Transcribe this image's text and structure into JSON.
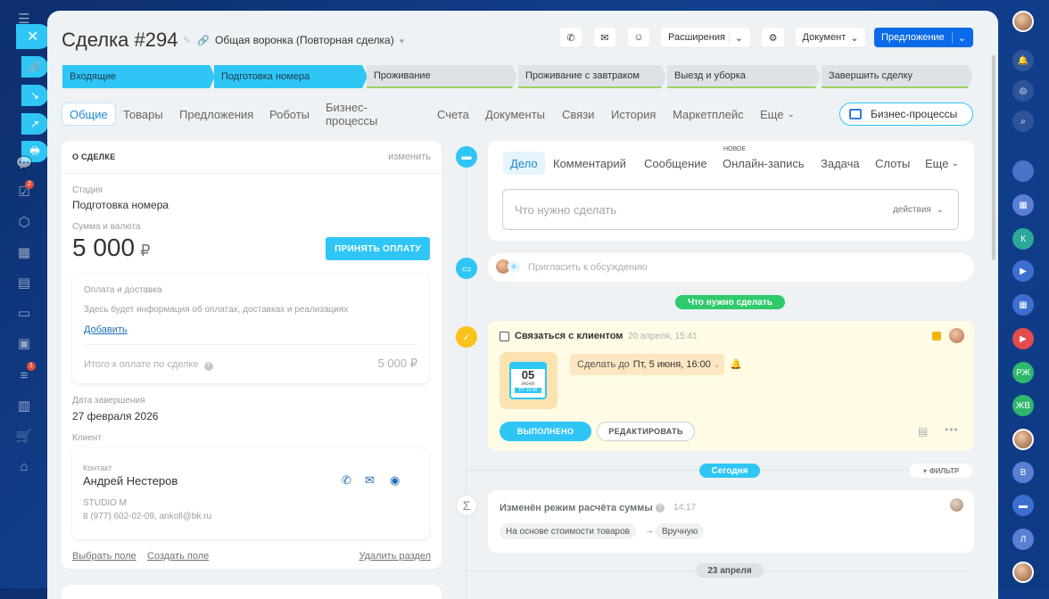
{
  "sidebar_left": {
    "badges": [
      "2",
      "1"
    ]
  },
  "header": {
    "title": "Сделка #294",
    "funnel": "Общая воронка (Повторная сделка)",
    "extensions": "Расширения",
    "document": "Документ",
    "offer": "Предложение"
  },
  "stages": [
    {
      "label": "Входящие",
      "state": "active"
    },
    {
      "label": "Подготовка номера",
      "state": "active"
    },
    {
      "label": "Проживание",
      "state": "inactive"
    },
    {
      "label": "Проживание с завтраком",
      "state": "inactive"
    },
    {
      "label": "Выезд и уборка",
      "state": "inactive"
    },
    {
      "label": "Завершить сделку",
      "state": "inactive"
    }
  ],
  "tabs": [
    "Общие",
    "Товары",
    "Предложения",
    "Роботы",
    "Бизнес-процессы",
    "Счета",
    "Документы",
    "Связи",
    "История",
    "Маркетплейс",
    "Еще"
  ],
  "bp_button": "Бизнес-процессы",
  "deal": {
    "section_title": "О СДЕЛКЕ",
    "edit": "изменить",
    "stage_label": "Стадия",
    "stage_value": "Подготовка номера",
    "sum_label": "Сумма и валюта",
    "sum_value": "5 000",
    "currency": "₽",
    "accept_payment": "ПРИНЯТЬ ОПЛАТУ",
    "payment_title": "Оплата и доставка",
    "payment_text": "Здесь будет информация об оплатах, доставках и реализациях",
    "add_link": "Добавить",
    "total_label": "Итого к оплате по сделке",
    "total_value": "5 000 ₽",
    "close_date_label": "Дата завершения",
    "close_date_value": "27 февраля 2026",
    "client_label": "Клиент",
    "contact_label": "Контакт",
    "contact_name": "Андрей Нестеров",
    "company": "STUDIO M",
    "contact_details": "8 (977) 602-02-09, ankoll@bk.ru",
    "choose_field": "Выбрать поле",
    "create_field": "Создать поле",
    "delete_section": "Удалить раздел"
  },
  "activity": {
    "tabs": [
      "Дело",
      "Комментарий",
      "Сообщение",
      "Онлайн-запись",
      "Задача",
      "Слоты",
      "Еще"
    ],
    "new_badge": "НОВОЕ",
    "todo_placeholder": "Что нужно сделать",
    "actions": "действия",
    "invite": "Пригласить к обсуждению"
  },
  "timeline": {
    "todo_pill": "Что нужно сделать",
    "task_title": "Связаться с клиентом",
    "task_time": "20 апреля, 15:41",
    "calendar_day": "05",
    "calendar_month": "июня",
    "calendar_weekday": "ПТ 16:00",
    "deadline_prefix": "Сделать до",
    "deadline_value": "Пт, 5 июня, 16:00",
    "done_button": "ВЫПОЛНЕНО",
    "edit_button": "РЕДАКТИРОВАТЬ",
    "today_pill": "Сегодня",
    "filter": "ФИЛЬТР",
    "change_title": "Изменён режим расчёта суммы",
    "change_time": "14:17",
    "change_from": "На основе стоимости товаров",
    "change_to": "Вручную",
    "date_pill": "23 апреля"
  },
  "colors": {
    "accent": "#2fc6f6",
    "primary": "#0b6ae8",
    "success": "#9bd35d",
    "task_bg": "#fffbe5"
  }
}
